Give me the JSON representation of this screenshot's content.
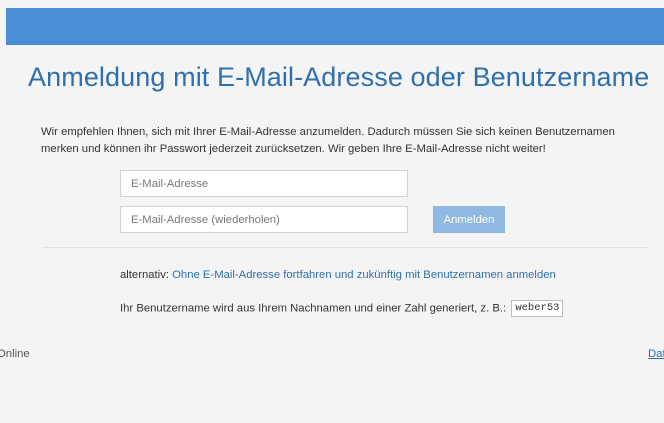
{
  "header": {
    "bar_color": "#4a8fd6"
  },
  "page": {
    "title": "Anmeldung mit E-Mail-Adresse oder Benutzername",
    "intro_line1": "Wir empfehlen Ihnen, sich mit Ihrer E-Mail-Adresse anzumelden. Dadurch müssen Sie sich keinen Benutzernamen",
    "intro_line2": "merken und können ihr Passwort jederzeit zurücksetzen. Wir geben Ihre E-Mail-Adresse nicht weiter!"
  },
  "form": {
    "email_placeholder": "E-Mail-Adresse",
    "email_value": "",
    "email_repeat_placeholder": "E-Mail-Adresse (wiederholen)",
    "email_repeat_value": "",
    "submit_label": "Anmelden"
  },
  "alternative": {
    "prefix": "alternativ:",
    "link_text": "Ohne E-Mail-Adresse fortfahren und zukünftig mit Benutzernamen anmelden"
  },
  "username_info": {
    "text": "Ihr Benutzername wird aus Ihrem Nachnamen und einer Zahl generiert, z. B.:",
    "example": "weber53"
  },
  "footer": {
    "left_text": "Online",
    "right_text": "Dat"
  },
  "colors": {
    "accent": "#2f6fad",
    "button": "#8fb9e3",
    "background": "#f4f4f4"
  }
}
